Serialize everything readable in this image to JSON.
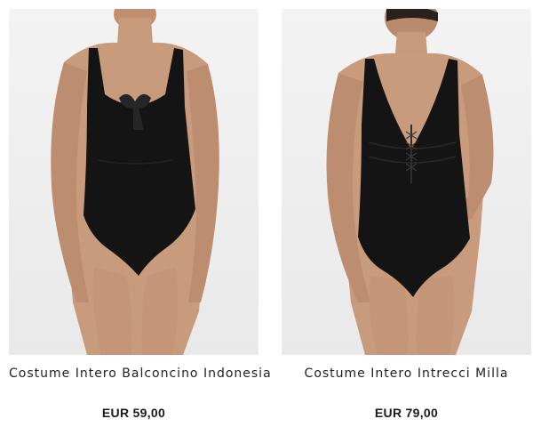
{
  "products": [
    {
      "name": "Costume Intero Balconcino Indonesia",
      "price": "EUR 59,00",
      "image_icon": "swimsuit-model-photo"
    },
    {
      "name": "Costume Intero Intrecci Milla",
      "price": "EUR 79,00",
      "image_icon": "swimsuit-model-photo"
    }
  ],
  "colors": {
    "background": "#ffffff",
    "photo_background": "#eeeeee",
    "swimsuit": "#141414",
    "skin": "#c89a7c",
    "text": "#222222"
  }
}
